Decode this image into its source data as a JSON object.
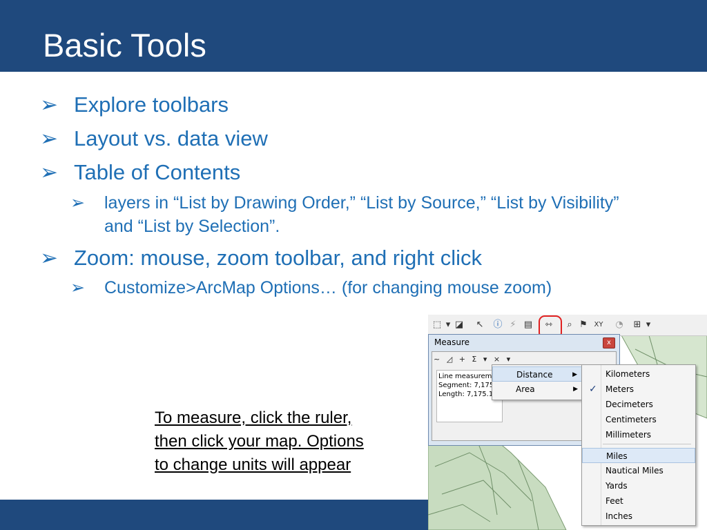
{
  "slide": {
    "title": "Basic Tools",
    "colors": {
      "header": "#1f497d",
      "bullet_text": "#1f6fb5"
    },
    "bullet_icon": "arrow-bullet-icon",
    "bullets": [
      {
        "text": "Explore toolbars"
      },
      {
        "text": "Layout vs. data view"
      },
      {
        "text": "Table of Contents"
      },
      {
        "sub": "layers in “List by Drawing Order,” “List by Source,” “List by Visibility”"
      },
      {
        "sub_cont": "and “List by Selection”."
      },
      {
        "text": "Zoom: mouse, zoom toolbar, and right click"
      },
      {
        "sub": "Customize>ArcMap Options… (for changing mouse zoom)"
      }
    ],
    "caption": [
      "To measure, click the ruler,",
      "then click your map. Options",
      "to change units will appear"
    ]
  },
  "screenshot": {
    "toolbar_icons": [
      "select-elements-icon",
      "dropdown-icon",
      "select-features-icon",
      "pointer-icon",
      "identify-icon",
      "hyperlink-icon",
      "html-popup-icon",
      "measure-ruler-icon",
      "find-icon",
      "find-route-icon",
      "go-to-xy-icon",
      "time-slider-icon",
      "create-viewer-icon"
    ],
    "measure_window": {
      "title": "Measure",
      "close_label": "x",
      "tool_symbols": [
        "~",
        "◿",
        "+",
        "Σ",
        "▾",
        "×",
        "▾"
      ],
      "readout": [
        "Line measureme",
        "Segment: 7,175",
        "Length: 7,175.1"
      ]
    },
    "menu1": [
      {
        "label": "Distance",
        "sub": "▶"
      },
      {
        "label": "Area",
        "sub": "▶"
      }
    ],
    "menu2": [
      "Kilometers",
      "Meters",
      "Decimeters",
      "Centimeters",
      "Millimeters",
      "Miles",
      "Nautical Miles",
      "Yards",
      "Feet",
      "Inches"
    ],
    "checked_unit": "Meters",
    "checkmark": "✓",
    "highlighted_unit": "Miles"
  }
}
